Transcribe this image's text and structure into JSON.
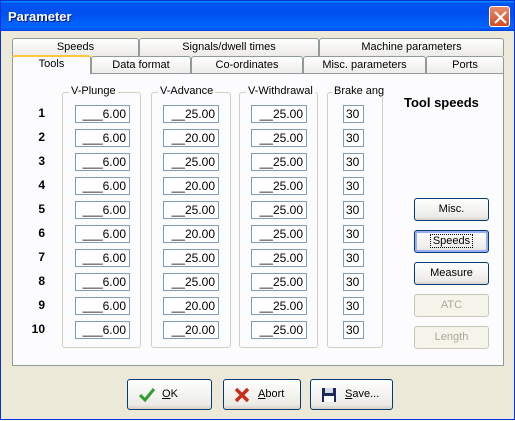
{
  "window": {
    "title": "Parameter"
  },
  "tabs_back": [
    "Speeds",
    "Signals/dwell times",
    "Machine parameters"
  ],
  "tabs_front": [
    "Tools",
    "Data format",
    "Co-ordinates",
    "Misc. parameters",
    "Ports"
  ],
  "active_tab": "Tools",
  "groups": {
    "plunge": "V-Plunge",
    "advance": "V-Advance",
    "withdrawal": "V-Withdrawal",
    "brake": "Brake ang"
  },
  "rows": [
    {
      "num": "1",
      "plunge": "___6.00",
      "advance": "__25.00",
      "withdrawal": "__25.00",
      "brake": "30"
    },
    {
      "num": "2",
      "plunge": "___6.00",
      "advance": "__20.00",
      "withdrawal": "__25.00",
      "brake": "30"
    },
    {
      "num": "3",
      "plunge": "___6.00",
      "advance": "__25.00",
      "withdrawal": "__25.00",
      "brake": "30"
    },
    {
      "num": "4",
      "plunge": "___6.00",
      "advance": "__20.00",
      "withdrawal": "__25.00",
      "brake": "30"
    },
    {
      "num": "5",
      "plunge": "___6.00",
      "advance": "__25.00",
      "withdrawal": "__25.00",
      "brake": "30"
    },
    {
      "num": "6",
      "plunge": "___6.00",
      "advance": "__20.00",
      "withdrawal": "__25.00",
      "brake": "30"
    },
    {
      "num": "7",
      "plunge": "___6.00",
      "advance": "__25.00",
      "withdrawal": "__25.00",
      "brake": "30"
    },
    {
      "num": "8",
      "plunge": "___6.00",
      "advance": "__25.00",
      "withdrawal": "__25.00",
      "brake": "30"
    },
    {
      "num": "9",
      "plunge": "___6.00",
      "advance": "__20.00",
      "withdrawal": "__25.00",
      "brake": "30"
    },
    {
      "num": "10",
      "plunge": "___6.00",
      "advance": "__20.00",
      "withdrawal": "__25.00",
      "brake": "30"
    }
  ],
  "side": {
    "heading": "Tool speeds",
    "buttons": [
      {
        "label": "Misc.",
        "enabled": true
      },
      {
        "label": "Speeds",
        "enabled": true,
        "focused": true
      },
      {
        "label": "Measure",
        "enabled": true
      },
      {
        "label": "ATC",
        "enabled": false
      },
      {
        "label": "Length",
        "enabled": false
      }
    ]
  },
  "footer": {
    "ok": "OK",
    "abort": "Abort",
    "save": "Save..."
  },
  "colors": {
    "titlebar": "#0053ee",
    "face": "#ece9d8",
    "ok_check": "#2e9e2e",
    "abort_x": "#cc2a1a"
  }
}
